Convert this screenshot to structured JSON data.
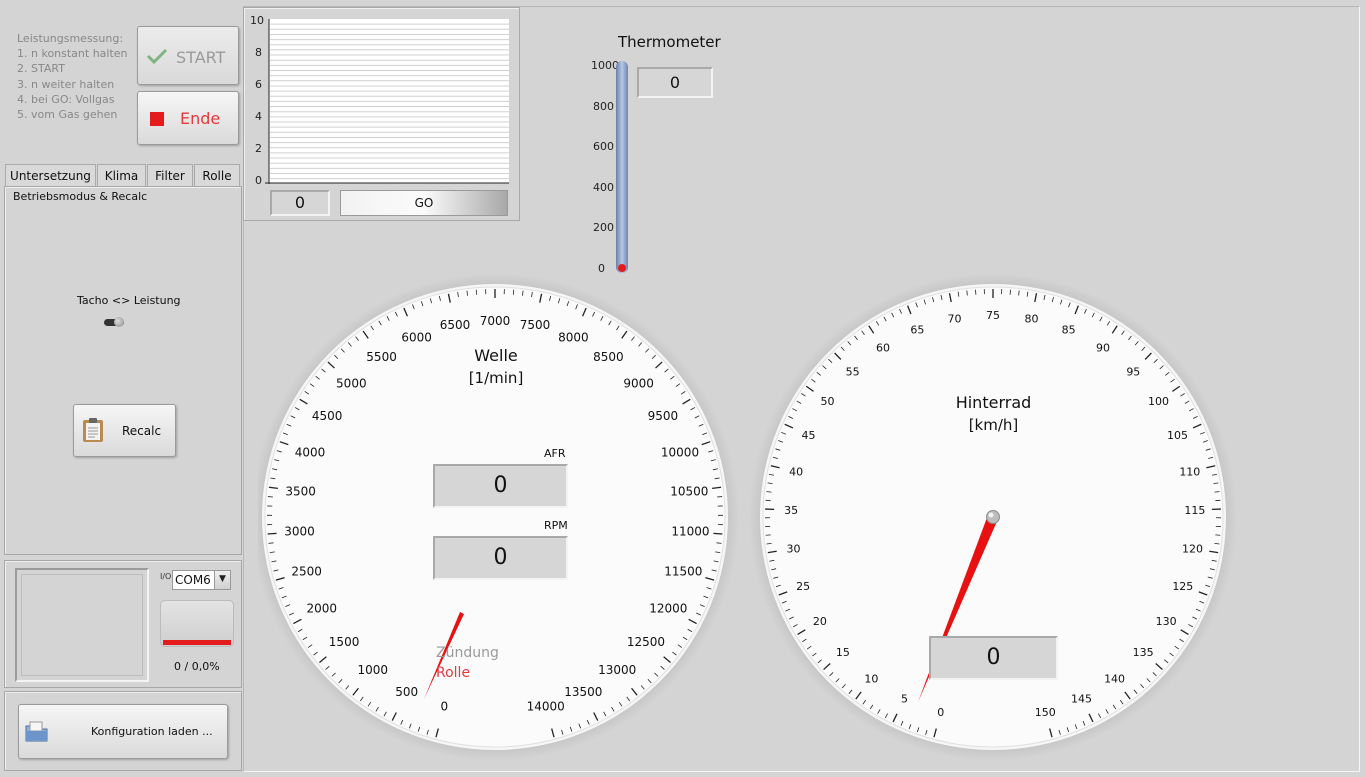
{
  "instructions": {
    "lines": [
      "Leistungsmessung:",
      "1. n konstant halten",
      "2. START",
      "3. n weiter halten",
      "4. bei GO: Vollgas",
      "5. vom Gas gehen"
    ]
  },
  "buttons": {
    "start_label": "START",
    "ende_label": "Ende",
    "recalc_label": "Recalc",
    "config_label": "Konfiguration laden ..."
  },
  "tabs": [
    {
      "label": "Untersetzung"
    },
    {
      "label": "Klima"
    },
    {
      "label": "Filter"
    },
    {
      "label": "Rolle"
    }
  ],
  "tab_panel": {
    "title": "Betriebsmodus & Recalc",
    "switch_label": "Tacho <> Leistung"
  },
  "com": {
    "io_label": "I/O",
    "port": "COM6",
    "progress_text": "0 / 0,0%",
    "progress_value": 0
  },
  "mini_chart": {
    "y_ticks": [
      "10",
      "8",
      "6",
      "4",
      "2",
      "0"
    ],
    "value": "0",
    "go_label": "GO"
  },
  "thermometer": {
    "title": "Thermometer",
    "ticks": [
      "1000",
      "800",
      "600",
      "400",
      "200",
      "0"
    ],
    "value_display": "0",
    "value": 0,
    "max": 1000
  },
  "welle_gauge": {
    "title": "Welle",
    "unit": "[1/min]",
    "min": 0,
    "max": 14000,
    "labels": [
      "0",
      "500",
      "1000",
      "1500",
      "2000",
      "2500",
      "3000",
      "3500",
      "4000",
      "4500",
      "5000",
      "5500",
      "6000",
      "6500",
      "7000",
      "7500",
      "8000",
      "8500",
      "9000",
      "9500",
      "10000",
      "10500",
      "11000",
      "11500",
      "12000",
      "12500",
      "13000",
      "13500",
      "14000"
    ],
    "needle_value": 0,
    "afr_label": "AFR",
    "afr_value": "0",
    "rpm_label": "RPM",
    "rpm_value": "0",
    "zuendung_label": "Zündung",
    "rolle_label": "Rolle"
  },
  "hinterrad_gauge": {
    "title": "Hinterrad",
    "unit": "[km/h]",
    "min": 0,
    "max": 150,
    "labels": [
      "0",
      "5",
      "10",
      "15",
      "20",
      "25",
      "30",
      "35",
      "40",
      "45",
      "50",
      "55",
      "60",
      "65",
      "70",
      "75",
      "80",
      "85",
      "90",
      "95",
      "100",
      "105",
      "110",
      "115",
      "120",
      "125",
      "130",
      "135",
      "140",
      "145",
      "150"
    ],
    "needle_value": 0,
    "value_display": "0"
  },
  "colors": {
    "needle": "#e81010",
    "stop_red": "#e41b1b",
    "ende_text": "#e33b3b",
    "start_check": "#7fb37f",
    "thermo_blue": "#8fa4c8"
  }
}
